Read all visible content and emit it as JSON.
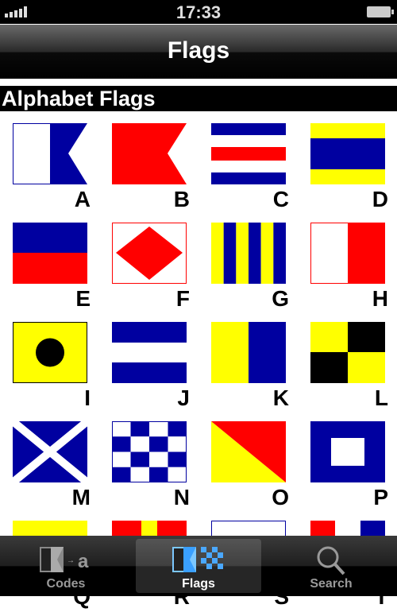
{
  "status": {
    "time": "17:33",
    "signal": "signal-bars-icon",
    "battery": "battery-charging-icon"
  },
  "nav": {
    "title": "Flags"
  },
  "section": {
    "title": "Alphabet Flags"
  },
  "flags": [
    {
      "letter": "A"
    },
    {
      "letter": "B"
    },
    {
      "letter": "C"
    },
    {
      "letter": "D"
    },
    {
      "letter": "E"
    },
    {
      "letter": "F"
    },
    {
      "letter": "G"
    },
    {
      "letter": "H"
    },
    {
      "letter": "I"
    },
    {
      "letter": "J"
    },
    {
      "letter": "K"
    },
    {
      "letter": "L"
    },
    {
      "letter": "M"
    },
    {
      "letter": "N"
    },
    {
      "letter": "O"
    },
    {
      "letter": "P"
    },
    {
      "letter": "Q"
    },
    {
      "letter": "R"
    },
    {
      "letter": "S"
    },
    {
      "letter": "T"
    }
  ],
  "colors": {
    "blue": "#0000a0",
    "red": "#ff0000",
    "yellow": "#ffff00",
    "black": "#000000",
    "white": "#ffffff"
  },
  "tabs": [
    {
      "label": "Codes",
      "icon": "flag-to-letter-icon"
    },
    {
      "label": "Flags",
      "icon": "flags-icon",
      "active": true
    },
    {
      "label": "Search",
      "icon": "search-icon"
    }
  ]
}
